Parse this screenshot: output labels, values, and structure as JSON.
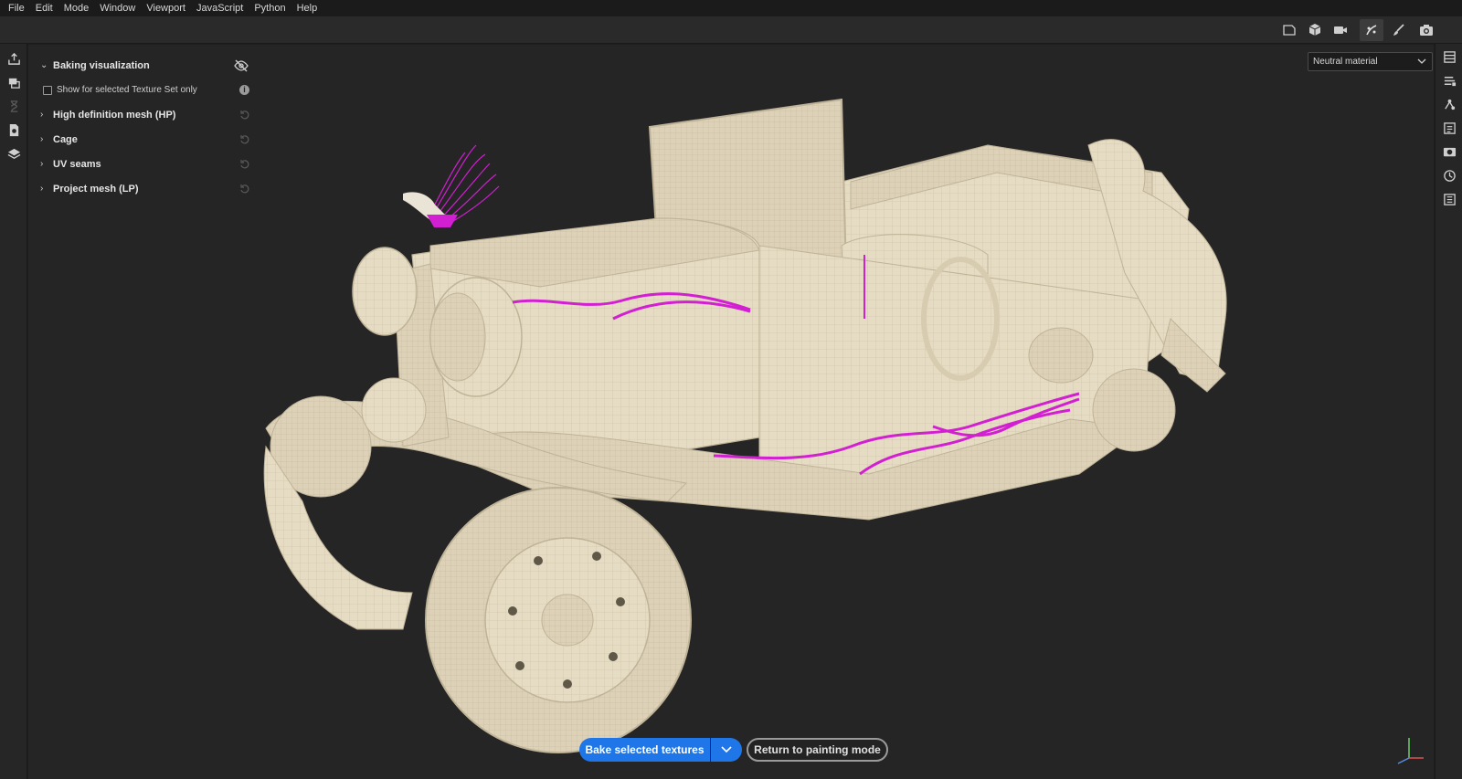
{
  "menubar": {
    "items": [
      "File",
      "Edit",
      "Mode",
      "Window",
      "Viewport",
      "JavaScript",
      "Python",
      "Help"
    ]
  },
  "toolbar": {
    "right_icons": [
      "frame-icon",
      "cube-icon",
      "camera-video-icon",
      "bake-mode-icon",
      "paint-brush-icon",
      "screenshot-camera-icon"
    ]
  },
  "left_strip": {
    "icons": [
      "export-icon",
      "texture-sets-icon",
      "hourglass-icon",
      "document-settings-icon",
      "layers-stack-icon"
    ]
  },
  "right_strip": {
    "icons": [
      "layers-icon",
      "properties-icon",
      "shelf-icon",
      "texture-set-list-icon",
      "display-settings-icon",
      "history-icon",
      "log-icon"
    ]
  },
  "panel": {
    "baking_visualization": "Baking visualization",
    "show_selected_only": "Show for selected Texture Set only",
    "sections": [
      {
        "label": "High definition mesh (HP)"
      },
      {
        "label": "Cage"
      },
      {
        "label": "UV seams"
      },
      {
        "label": "Project mesh (LP)"
      }
    ]
  },
  "material_select": {
    "value": "Neutral material"
  },
  "actions": {
    "bake_label": "Bake selected textures",
    "return_label": "Return to painting mode"
  },
  "colors": {
    "accent": "#1f76e8",
    "highlight_mesh": "#d21fd2",
    "model_base": "#e7dcc4"
  }
}
